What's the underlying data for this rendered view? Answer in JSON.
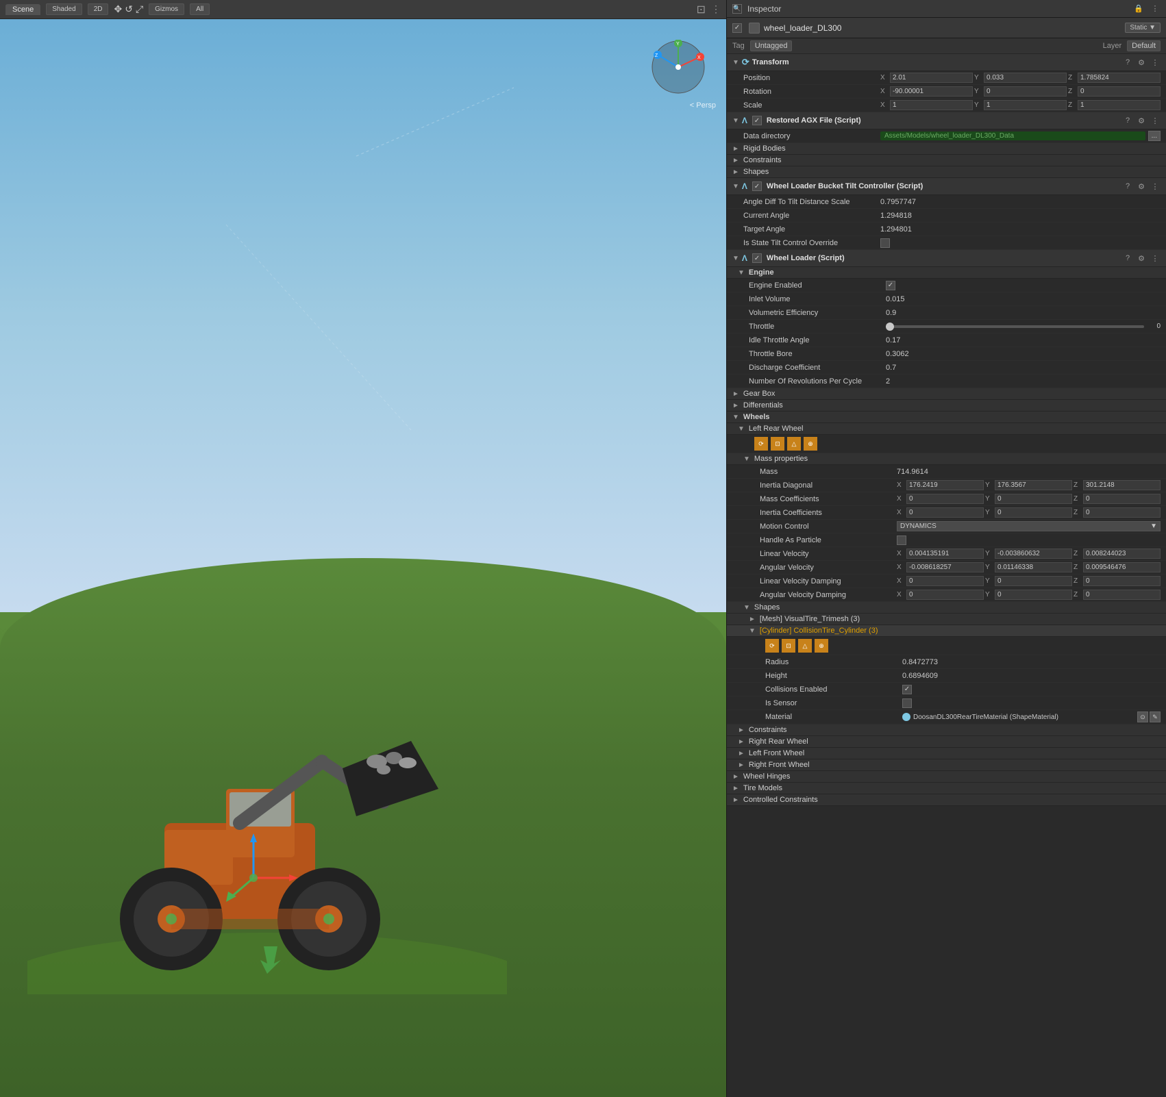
{
  "scene": {
    "tab": "Scene",
    "mode": "Shaded",
    "view2d": "2D",
    "gizmos": "Gizmos",
    "all": "All",
    "persp": "< Persp"
  },
  "inspector": {
    "title": "Inspector",
    "object": {
      "name": "wheel_loader_DL300",
      "static": "Static ▼",
      "tag_label": "Tag",
      "tag_value": "Untagged",
      "layer_label": "Layer",
      "layer_value": "Default"
    },
    "transform": {
      "title": "Transform",
      "position_label": "Position",
      "position": {
        "x": "2.01",
        "y": "0.033",
        "z": "1.785824"
      },
      "rotation_label": "Rotation",
      "rotation": {
        "x": "-90.00001",
        "y": "0",
        "z": "0"
      },
      "scale_label": "Scale",
      "scale": {
        "x": "1",
        "y": "1",
        "z": "1"
      }
    },
    "restored_agx": {
      "title": "Restored AGX File (Script)",
      "data_directory_label": "Data directory",
      "data_directory_value": "Assets/Models/wheel_loader_DL300_Data"
    },
    "rigid_bodies": {
      "title": "Rigid Bodies"
    },
    "constraints": {
      "title": "Constraints"
    },
    "shapes": {
      "title": "Shapes"
    },
    "bucket_tilt": {
      "title": "Wheel Loader Bucket Tilt Controller (Script)",
      "angle_diff_label": "Angle Diff To Tilt Distance Scale",
      "angle_diff_value": "0.7957747",
      "current_angle_label": "Current Angle",
      "current_angle_value": "1.294818",
      "target_angle_label": "Target Angle",
      "target_angle_value": "1.294801",
      "is_state_label": "Is State Tilt Control Override"
    },
    "wheel_loader": {
      "title": "Wheel Loader (Script)",
      "engine_section": "Engine",
      "engine_enabled_label": "Engine Enabled",
      "inlet_volume_label": "Inlet Volume",
      "inlet_volume_value": "0.015",
      "volumetric_efficiency_label": "Volumetric Efficiency",
      "volumetric_efficiency_value": "0.9",
      "throttle_label": "Throttle",
      "throttle_value": "0",
      "idle_throttle_label": "Idle Throttle Angle",
      "idle_throttle_value": "0.17",
      "throttle_bore_label": "Throttle Bore",
      "throttle_bore_value": "0.3062",
      "discharge_coeff_label": "Discharge Coefficient",
      "discharge_coeff_value": "0.7",
      "num_revolutions_label": "Number Of Revolutions Per Cycle",
      "num_revolutions_value": "2",
      "gear_box": "Gear Box",
      "differentials": "Differentials",
      "wheels": "Wheels",
      "left_rear_wheel": "Left Rear Wheel",
      "mass_properties": "Mass properties",
      "mass_label": "Mass",
      "mass_value": "714.9614",
      "inertia_diagonal_label": "Inertia Diagonal",
      "inertia_diagonal": {
        "x": "176.2419",
        "y": "176.3567",
        "z": "301.2148"
      },
      "mass_coefficients_label": "Mass Coefficients",
      "mass_coefficients": {
        "x": "0",
        "y": "0",
        "z": "0"
      },
      "inertia_coefficients_label": "Inertia Coefficients",
      "inertia_coefficients": {
        "x": "0",
        "y": "0",
        "z": "0"
      },
      "motion_control_label": "Motion Control",
      "motion_control_value": "DYNAMICS",
      "handle_as_particle_label": "Handle As Particle",
      "linear_velocity_label": "Linear Velocity",
      "linear_velocity": {
        "x": "0.004135191",
        "y": "-0.003860632",
        "z": "0.008244023"
      },
      "angular_velocity_label": "Angular Velocity",
      "angular_velocity": {
        "x": "-0.008618257",
        "y": "0.01146338",
        "z": "0.009546476"
      },
      "linear_velocity_damping_label": "Linear Velocity Damping",
      "linear_velocity_damping": {
        "x": "0",
        "y": "0",
        "z": "0"
      },
      "angular_velocity_damping_label": "Angular Velocity Damping",
      "angular_velocity_damping": {
        "x": "0",
        "y": "0",
        "z": "0"
      },
      "shapes_section": "Shapes",
      "mesh_visual_tire": "[Mesh] VisualTire_Trimesh (3)",
      "cylinder_collision": "[Cylinder] CollisionTire_Cylinder (3)",
      "radius_label": "Radius",
      "radius_value": "0.8472773",
      "height_label": "Height",
      "height_value": "0.6894609",
      "collisions_enabled_label": "Collisions Enabled",
      "is_sensor_label": "Is Sensor",
      "material_label": "Material",
      "material_value": "DoosanDL300RearTireMaterial (ShapeMaterial)",
      "constraints_label": "Constraints",
      "right_rear_wheel": "Right Rear Wheel",
      "left_front_wheel": "Left Front Wheel",
      "right_front_wheel": "Right Front Wheel",
      "wheel_hinges": "Wheel Hinges",
      "tire_models": "Tire Models",
      "controlled_constraints": "Controlled Constraints"
    }
  }
}
